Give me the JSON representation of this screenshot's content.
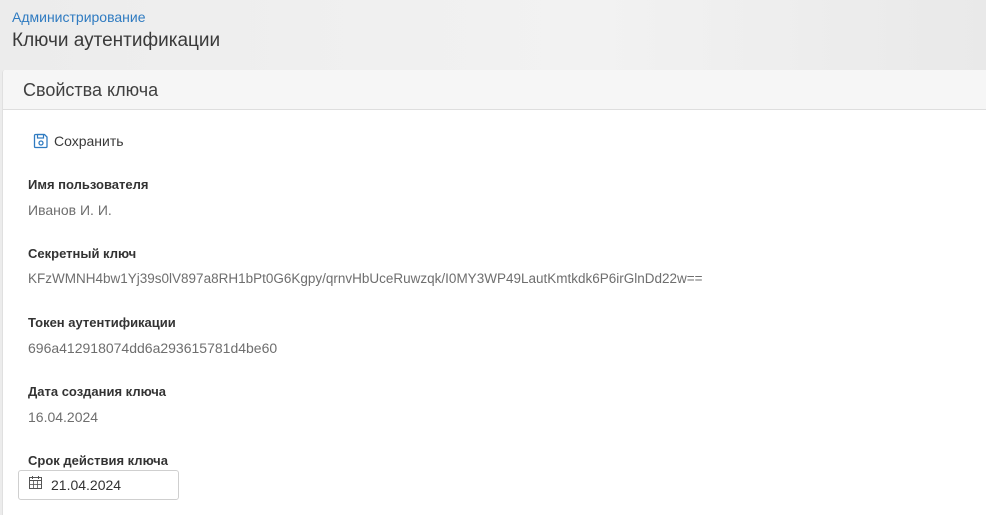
{
  "header": {
    "breadcrumb": "Администрирование",
    "title": "Ключи аутентификации"
  },
  "panel": {
    "title": "Свойства ключа",
    "toolbar": {
      "save_label": "Сохранить",
      "save_icon": "save-icon"
    },
    "fields": {
      "username": {
        "label": "Имя пользователя",
        "value": "Иванов И. И."
      },
      "secret_key": {
        "label": "Секретный ключ",
        "value": "KFzWMNH4bw1Yj39s0lV897a8RH1bPt0G6Kgpy/qrnvHbUceRuwzqk/I0MY3WP49LautKmtkdk6P6irGlnDd22w=="
      },
      "auth_token": {
        "label": "Токен аутентификации",
        "value": "696a412918074dd6a293615781d4be60"
      },
      "created_date": {
        "label": "Дата создания ключа",
        "value": "16.04.2024"
      },
      "expiry_date": {
        "label": "Срок действия ключа",
        "value": "21.04.2024",
        "icon": "calendar-icon"
      }
    }
  },
  "colors": {
    "link": "#2f7bc1",
    "header_bg": "#ececec",
    "panel_header_bg": "#f6f6f6"
  }
}
